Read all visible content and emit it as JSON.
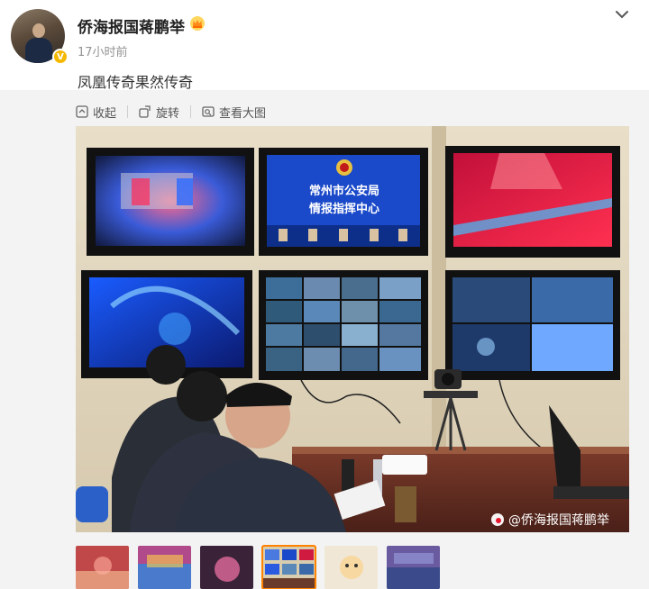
{
  "post": {
    "username": "侨海报国蒋鹏举",
    "time": "17小时前",
    "text": "凤凰传奇果然传奇"
  },
  "toolbar": {
    "collapse_label": "收起",
    "rotate_label": "旋转",
    "view_large_label": "查看大图"
  },
  "image": {
    "sign_line1": "常州市公安局",
    "sign_line2": "情报指挥中心",
    "watermark": "@侨海报国蒋鹏举"
  },
  "icons": {
    "crown": "crown-icon",
    "verified": "verified-badge-icon",
    "chevron": "chevron-down-icon",
    "collapse": "collapse-icon",
    "rotate": "rotate-icon",
    "view_large": "view-large-icon",
    "weibo": "weibo-logo-icon"
  },
  "colors": {
    "accent": "#ff8200",
    "verified": "#f5b800",
    "sign_blue": "#1a49c9"
  },
  "thumbnails": [
    {
      "scene": "stage-red"
    },
    {
      "scene": "crowd-color"
    },
    {
      "scene": "stage-pink"
    },
    {
      "scene": "monitor-wall",
      "selected": true
    },
    {
      "scene": "cartoon"
    },
    {
      "scene": "stage-blue"
    }
  ]
}
